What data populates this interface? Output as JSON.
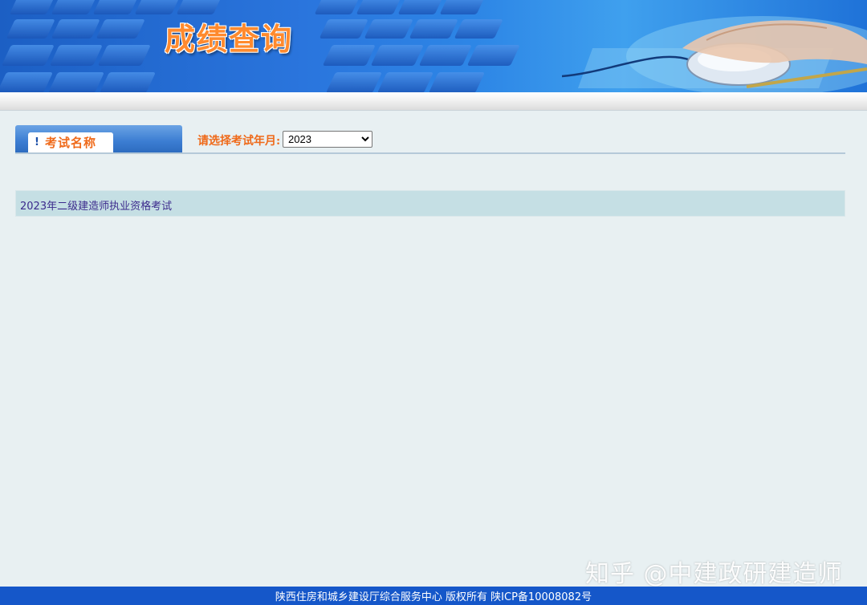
{
  "banner": {
    "title": "成绩查询"
  },
  "tab": {
    "icon": "exclamation",
    "label": "考试名称"
  },
  "year_filter": {
    "label": "请选择考试年月:",
    "selected": "2023"
  },
  "exams": [
    {
      "name": "2023年二级建造师执业资格考试"
    }
  ],
  "watermark": "知乎 @中建政研建造师",
  "footer": {
    "text": "陕西住房和城乡建设厅综合服务中心 版权所有 陕ICP备10008082号"
  },
  "colors": {
    "accent_orange": "#ef6a1a",
    "footer_blue": "#1557c9",
    "row_bg": "#c5dfe4",
    "link": "#3b2a8c"
  }
}
